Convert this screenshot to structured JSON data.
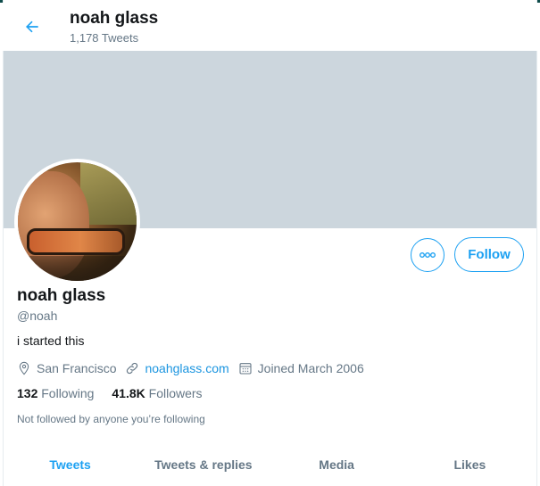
{
  "header": {
    "title": "noah glass",
    "tweet_count": "1,178 Tweets"
  },
  "profile": {
    "name": "noah glass",
    "handle": "@noah",
    "bio": "i started this",
    "location": "San Francisco",
    "website": "noahglass.com",
    "joined": "Joined March 2006",
    "following_count": "132",
    "following_label": "Following",
    "followers_count": "41.8K",
    "followers_label": "Followers",
    "follow_context": "Not followed by anyone you’re following"
  },
  "actions": {
    "follow_label": "Follow"
  },
  "tabs": [
    {
      "label": "Tweets",
      "active": true
    },
    {
      "label": "Tweets & replies",
      "active": false
    },
    {
      "label": "Media",
      "active": false
    },
    {
      "label": "Likes",
      "active": false
    }
  ],
  "colors": {
    "accent": "#1da1f2",
    "banner": "#ccd6dd",
    "secondary_text": "#657786"
  }
}
